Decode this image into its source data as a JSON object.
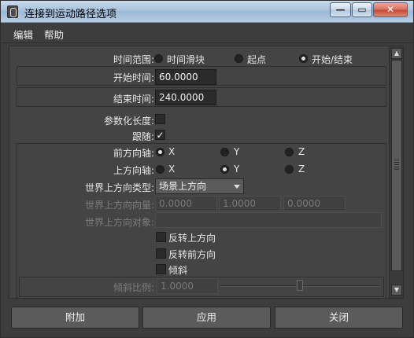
{
  "window": {
    "title": "连接到运动路径选项",
    "minimize_glyph": "—",
    "maximize_glyph": "▭",
    "close_glyph": "✕"
  },
  "menu": {
    "items": [
      "编辑",
      "帮助"
    ]
  },
  "time_range": {
    "label": "时间范围:",
    "options": [
      "时间滑块",
      "起点",
      "开始/结束"
    ],
    "selected": "开始/结束"
  },
  "start_time": {
    "label": "开始时间:",
    "value": "60.0000"
  },
  "end_time": {
    "label": "结束时间:",
    "value": "240.0000"
  },
  "parametric_length": {
    "label": "参数化长度:",
    "checked": false
  },
  "follow": {
    "label": "跟随:",
    "checked": true,
    "checkmark": "✓"
  },
  "front_axis": {
    "label": "前方向轴:",
    "options": [
      "X",
      "Y",
      "Z"
    ],
    "selected": "X"
  },
  "up_axis": {
    "label": "上方向轴:",
    "options": [
      "X",
      "Y",
      "Z"
    ],
    "selected": "Y"
  },
  "world_up_type": {
    "label": "世界上方向类型:",
    "value": "场景上方向"
  },
  "world_up_vector": {
    "label": "世界上方向向量:",
    "values": [
      "0.0000",
      "1.0000",
      "0.0000"
    ]
  },
  "world_up_object": {
    "label": "世界上方向对象:",
    "value": ""
  },
  "checkboxes": {
    "inverse_up": {
      "label": "反转上方向",
      "checked": false
    },
    "inverse_front": {
      "label": "反转前方向",
      "checked": false
    },
    "bank": {
      "label": "倾斜",
      "checked": false
    }
  },
  "bank_scale": {
    "label": "倾斜比例:",
    "value": "1.0000",
    "slider_fraction": 0.5
  },
  "scrollbar": {
    "up_glyph": "▲",
    "down_glyph": "▼"
  },
  "buttons": {
    "attach": "附加",
    "apply": "应用",
    "close": "关闭"
  }
}
